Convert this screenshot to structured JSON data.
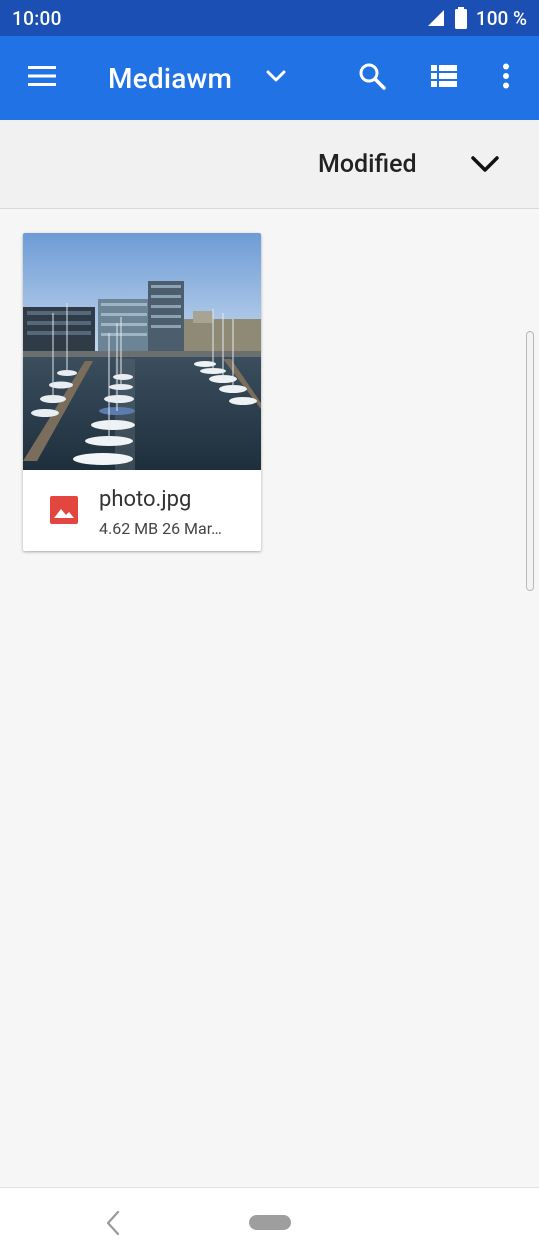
{
  "status_bar": {
    "time": "10:00",
    "battery_text": "100 %",
    "icons": [
      "signal-icon",
      "battery-icon"
    ]
  },
  "app_bar": {
    "title": "Mediawm",
    "icons": [
      "menu-icon",
      "chevron-down-icon",
      "search-icon",
      "list-view-icon",
      "more-vert-icon"
    ]
  },
  "sort_bar": {
    "label": "Modified",
    "icon": "chevron-down-icon"
  },
  "files": [
    {
      "name": "photo.jpg",
      "meta": "4.62 MB 26 Mar…",
      "icon": "image-file-icon",
      "thumbnail": "harbor-marina-photo"
    }
  ],
  "colors": {
    "status_bar": "#1b4fb4",
    "app_bar": "#2172e5",
    "image_icon": "#e2463f",
    "content_bg": "#f6f6f6"
  },
  "nav_bar": {
    "icons": [
      "back-icon",
      "home-pill-icon"
    ]
  }
}
